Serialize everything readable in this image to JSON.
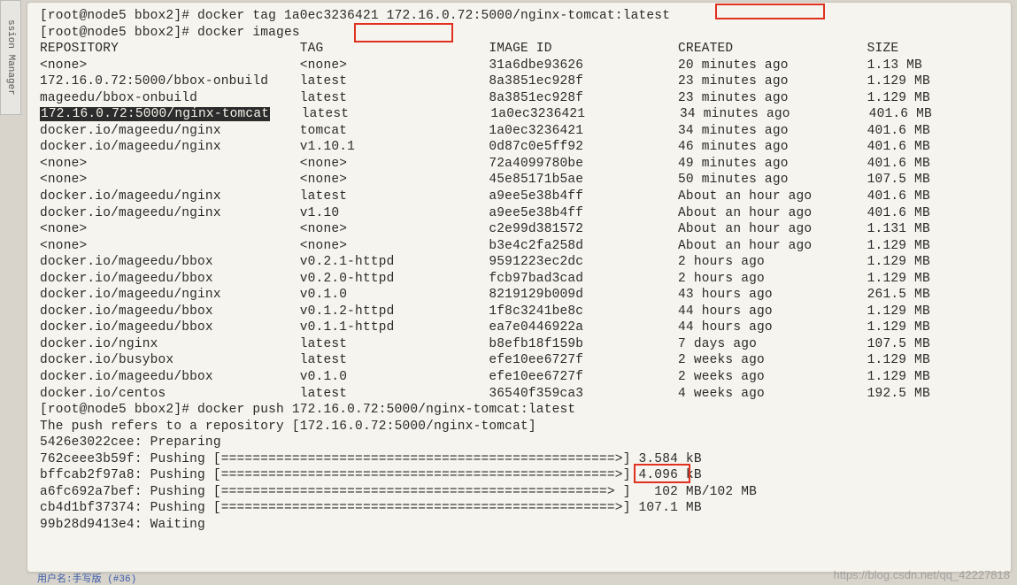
{
  "sidebar_tab": "ssion Manager",
  "prompt_user": "[root@node5 bbox2]#",
  "commands": {
    "tag": "docker tag 1a0ec3236421 172.16.0.72:5000/nginx-tomcat:latest",
    "images": "docker images",
    "push": "docker push 172.16.0.72:5000/nginx-tomcat:latest"
  },
  "table": {
    "headers": [
      "REPOSITORY",
      "TAG",
      "IMAGE ID",
      "CREATED",
      "SIZE"
    ],
    "rows": [
      {
        "repo": "<none>",
        "tag": "<none>",
        "id": "31a6dbe93626",
        "created": "20 minutes ago",
        "size": "1.13 MB",
        "hl": false
      },
      {
        "repo": "172.16.0.72:5000/bbox-onbuild",
        "tag": "latest",
        "id": "8a3851ec928f",
        "created": "23 minutes ago",
        "size": "1.129 MB",
        "hl": false
      },
      {
        "repo": "mageedu/bbox-onbuild",
        "tag": "latest",
        "id": "8a3851ec928f",
        "created": "23 minutes ago",
        "size": "1.129 MB",
        "hl": false
      },
      {
        "repo": "172.16.0.72:5000/nginx-tomcat",
        "tag": "latest",
        "id": "1a0ec3236421",
        "created": "34 minutes ago",
        "size": "401.6 MB",
        "hl": true
      },
      {
        "repo": "docker.io/mageedu/nginx",
        "tag": "tomcat",
        "id": "1a0ec3236421",
        "created": "34 minutes ago",
        "size": "401.6 MB",
        "hl": false
      },
      {
        "repo": "docker.io/mageedu/nginx",
        "tag": "v1.10.1",
        "id": "0d87c0e5ff92",
        "created": "46 minutes ago",
        "size": "401.6 MB",
        "hl": false
      },
      {
        "repo": "<none>",
        "tag": "<none>",
        "id": "72a4099780be",
        "created": "49 minutes ago",
        "size": "401.6 MB",
        "hl": false
      },
      {
        "repo": "<none>",
        "tag": "<none>",
        "id": "45e85171b5ae",
        "created": "50 minutes ago",
        "size": "107.5 MB",
        "hl": false
      },
      {
        "repo": "docker.io/mageedu/nginx",
        "tag": "latest",
        "id": "a9ee5e38b4ff",
        "created": "About an hour ago",
        "size": "401.6 MB",
        "hl": false
      },
      {
        "repo": "docker.io/mageedu/nginx",
        "tag": "v1.10",
        "id": "a9ee5e38b4ff",
        "created": "About an hour ago",
        "size": "401.6 MB",
        "hl": false
      },
      {
        "repo": "<none>",
        "tag": "<none>",
        "id": "c2e99d381572",
        "created": "About an hour ago",
        "size": "1.131 MB",
        "hl": false
      },
      {
        "repo": "<none>",
        "tag": "<none>",
        "id": "b3e4c2fa258d",
        "created": "About an hour ago",
        "size": "1.129 MB",
        "hl": false
      },
      {
        "repo": "docker.io/mageedu/bbox",
        "tag": "v0.2.1-httpd",
        "id": "9591223ec2dc",
        "created": "2 hours ago",
        "size": "1.129 MB",
        "hl": false
      },
      {
        "repo": "docker.io/mageedu/bbox",
        "tag": "v0.2.0-httpd",
        "id": "fcb97bad3cad",
        "created": "2 hours ago",
        "size": "1.129 MB",
        "hl": false
      },
      {
        "repo": "docker.io/mageedu/nginx",
        "tag": "v0.1.0",
        "id": "8219129b009d",
        "created": "43 hours ago",
        "size": "261.5 MB",
        "hl": false
      },
      {
        "repo": "docker.io/mageedu/bbox",
        "tag": "v0.1.2-httpd",
        "id": "1f8c3241be8c",
        "created": "44 hours ago",
        "size": "1.129 MB",
        "hl": false
      },
      {
        "repo": "docker.io/mageedu/bbox",
        "tag": "v0.1.1-httpd",
        "id": "ea7e0446922a",
        "created": "44 hours ago",
        "size": "1.129 MB",
        "hl": false
      },
      {
        "repo": "docker.io/nginx",
        "tag": "latest",
        "id": "b8efb18f159b",
        "created": "7 days ago",
        "size": "107.5 MB",
        "hl": false
      },
      {
        "repo": "docker.io/busybox",
        "tag": "latest",
        "id": "efe10ee6727f",
        "created": "2 weeks ago",
        "size": "1.129 MB",
        "hl": false
      },
      {
        "repo": "docker.io/mageedu/bbox",
        "tag": "v0.1.0",
        "id": "efe10ee6727f",
        "created": "2 weeks ago",
        "size": "1.129 MB",
        "hl": false
      },
      {
        "repo": "docker.io/centos",
        "tag": "latest",
        "id": "36540f359ca3",
        "created": "4 weeks ago",
        "size": "192.5 MB",
        "hl": false
      }
    ]
  },
  "push_output": {
    "refers": "The push refers to a repository [172.16.0.72:5000/nginx-tomcat]",
    "layers": [
      {
        "id": "5426e3022cee",
        "status": "Preparing",
        "bar": "",
        "val": ""
      },
      {
        "id": "762ceee3b59f",
        "status": "Pushing",
        "bar": "[==================================================>]",
        "val": "3.584 kB"
      },
      {
        "id": "bffcab2f97a8",
        "status": "Pushing",
        "bar": "[==================================================>]",
        "val": "4.096 kB"
      },
      {
        "id": "a6fc692a7bef",
        "status": "Pushing",
        "bar": "[=================================================> ]",
        "val": "  102 MB/102 MB"
      },
      {
        "id": "cb4d1bf37374",
        "status": "Pushing",
        "bar": "[==================================================>]",
        "val": "107.1 MB"
      },
      {
        "id": "99b28d9413e4",
        "status": "Waiting",
        "bar": "",
        "val": ""
      }
    ]
  },
  "watermark": "https://blog.csdn.net/qq_42227818",
  "footer": "用户名:手写版 (#36)"
}
